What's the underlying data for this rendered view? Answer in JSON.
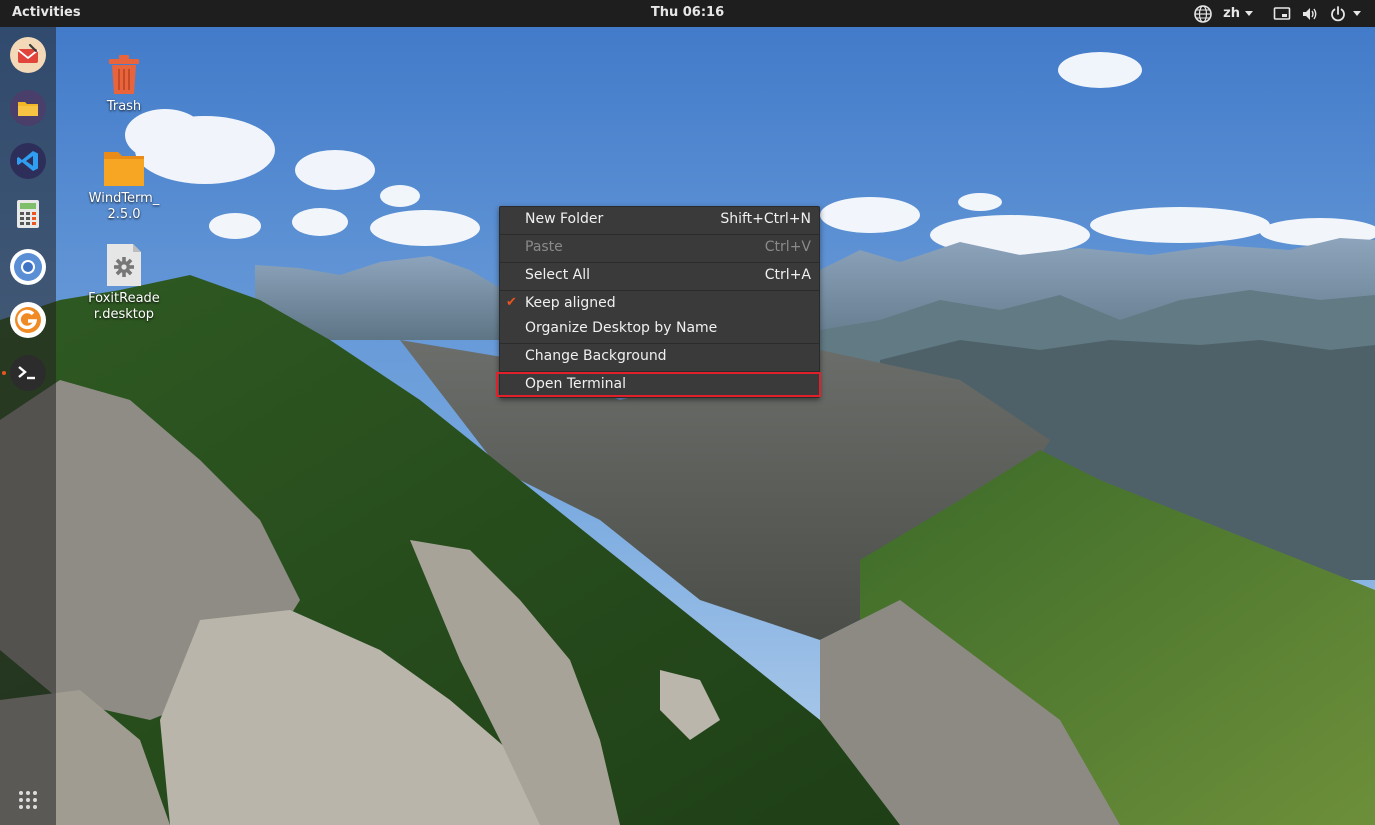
{
  "topbar": {
    "activities_label": "Activities",
    "clock": "Thu 06:16",
    "language": "zh",
    "icons": [
      "network-globe-icon",
      "window-icon",
      "volume-icon",
      "power-icon"
    ]
  },
  "dock": {
    "apps": [
      {
        "name": "mail-app-icon"
      },
      {
        "name": "files-icon"
      },
      {
        "name": "vscode-icon"
      },
      {
        "name": "calculator-icon"
      },
      {
        "name": "chromium-icon"
      },
      {
        "name": "foxit-icon"
      },
      {
        "name": "terminal-icon"
      }
    ],
    "show_apps_icon": "show-applications-icon"
  },
  "desktop": {
    "icons": [
      {
        "label": "Trash",
        "icon": "trash-icon"
      },
      {
        "label": "WindTerm_\n2.5.0",
        "icon": "folder-icon"
      },
      {
        "label": "FoxitReade\nr.desktop",
        "icon": "gear-file-icon"
      }
    ]
  },
  "context_menu": {
    "items": [
      {
        "label": "New Folder",
        "accel": "Shift+Ctrl+N",
        "enabled": true
      },
      {
        "label": "Paste",
        "accel": "Ctrl+V",
        "enabled": false
      },
      {
        "label": "Select All",
        "accel": "Ctrl+A",
        "enabled": true
      },
      {
        "label": "Keep aligned",
        "checked": true,
        "enabled": true
      },
      {
        "label": "Organize Desktop by Name",
        "enabled": true
      },
      {
        "label": "Change Background",
        "enabled": true
      },
      {
        "label": "Open Terminal",
        "enabled": true,
        "highlighted": true
      }
    ],
    "check_glyph": "✔"
  },
  "colors": {
    "accent": "#e95420",
    "highlight_box": "#e0202a",
    "menu_bg": "#3a3a3a",
    "topbar_bg": "#1e1e1e"
  }
}
